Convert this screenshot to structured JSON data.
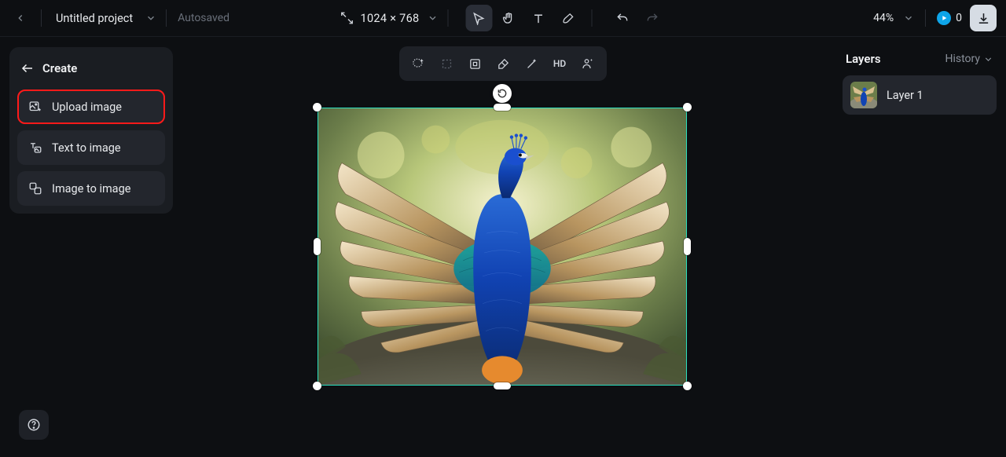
{
  "topbar": {
    "project_name": "Untitled project",
    "autosaved": "Autosaved",
    "dimensions": "1024 × 768",
    "zoom": "44%",
    "credits": "0"
  },
  "left_panel": {
    "title": "Create",
    "items": [
      {
        "label": "Upload image"
      },
      {
        "label": "Text to image"
      },
      {
        "label": "Image to image"
      }
    ]
  },
  "canvas_toolbar": {
    "hd_label": "HD"
  },
  "right_panel": {
    "title": "Layers",
    "history": "History",
    "layers": [
      {
        "name": "Layer 1"
      }
    ]
  }
}
